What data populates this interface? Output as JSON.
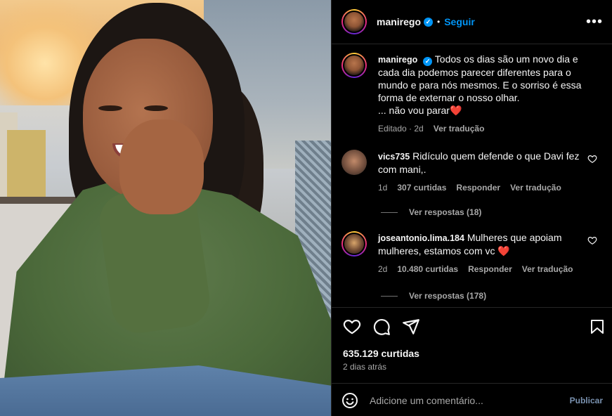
{
  "post": {
    "username": "manirego",
    "follow_label": "Seguir",
    "separator": "•",
    "more_label": "•••"
  },
  "caption": {
    "username": "manirego",
    "text": "Todos os dias são um novo dia e cada dia podemos parecer diferentes para o mundo e para nós mesmos. E o sorriso é essa forma de externar o nosso olhar.",
    "text2": "... não vou parar",
    "heart": "❤️",
    "edited": "Editado",
    "age": "2d",
    "translate": "Ver tradução"
  },
  "comments": [
    {
      "username": "vics735",
      "text": "Ridículo quem defende o que Davi fez com mani,.",
      "age": "1d",
      "likes": "307 curtidas",
      "reply": "Responder",
      "translate": "Ver tradução",
      "view_replies": "Ver respostas (18)"
    },
    {
      "username": "joseantonio.lima.184",
      "text": "Mulheres que apoiam mulheres, estamos com vc",
      "heart": "❤️",
      "age": "2d",
      "likes": "10.480 curtidas",
      "reply": "Responder",
      "translate": "Ver tradução",
      "view_replies": "Ver respostas (178)"
    }
  ],
  "footer": {
    "likes": "635.129 curtidas",
    "date": "2 dias atrás",
    "comment_placeholder": "Adicione um comentário...",
    "publish_label": "Publicar"
  },
  "colors": {
    "accent": "#0095f6",
    "background": "#000000",
    "text": "#f5f5f5",
    "muted": "#a8a8a8",
    "heart": "#ff3040"
  },
  "icons": [
    "heart-icon",
    "comment-icon",
    "share-icon",
    "bookmark-icon",
    "emoji-icon",
    "more-options-icon",
    "verified-badge-icon"
  ]
}
